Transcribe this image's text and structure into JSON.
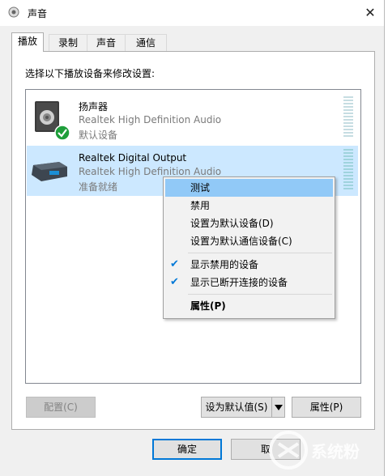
{
  "window": {
    "title": "声音",
    "close_glyph": "✕"
  },
  "tabs": [
    {
      "label": "播放",
      "active": true
    },
    {
      "label": "录制",
      "active": false
    },
    {
      "label": "声音",
      "active": false
    },
    {
      "label": "通信",
      "active": false
    }
  ],
  "instruction": "选择以下播放设备来修改设置:",
  "devices": [
    {
      "name": "扬声器",
      "driver": "Realtek High Definition Audio",
      "status": "默认设备",
      "icon": "speaker-icon",
      "default": true,
      "selected": false
    },
    {
      "name": "Realtek Digital Output",
      "driver": "Realtek High Definition Audio",
      "status": "准备就绪",
      "icon": "digital-output-icon",
      "default": false,
      "selected": true
    }
  ],
  "context_menu": [
    {
      "label": "测试",
      "checked": false,
      "highlighted": true
    },
    {
      "label": "禁用",
      "checked": false,
      "highlighted": false
    },
    {
      "label": "设置为默认设备(D)",
      "checked": false,
      "highlighted": false
    },
    {
      "label": "设置为默认通信设备(C)",
      "checked": false,
      "highlighted": false
    },
    {
      "label": "显示禁用的设备",
      "checked": true,
      "highlighted": false
    },
    {
      "label": "显示已断开连接的设备",
      "checked": true,
      "highlighted": false
    },
    {
      "label": "属性(P)",
      "checked": false,
      "highlighted": false,
      "bold": true
    }
  ],
  "buttons": {
    "configure": "配置(C)",
    "set_default": "设为默认值(S)",
    "properties": "属性(P)",
    "ok": "确定",
    "cancel": "取"
  },
  "watermark": "系统粉",
  "colors": {
    "accent": "#0078d7",
    "selection": "#cce8ff",
    "menu_highlight": "#91c9f7",
    "check_green": "#1e9e3a"
  }
}
